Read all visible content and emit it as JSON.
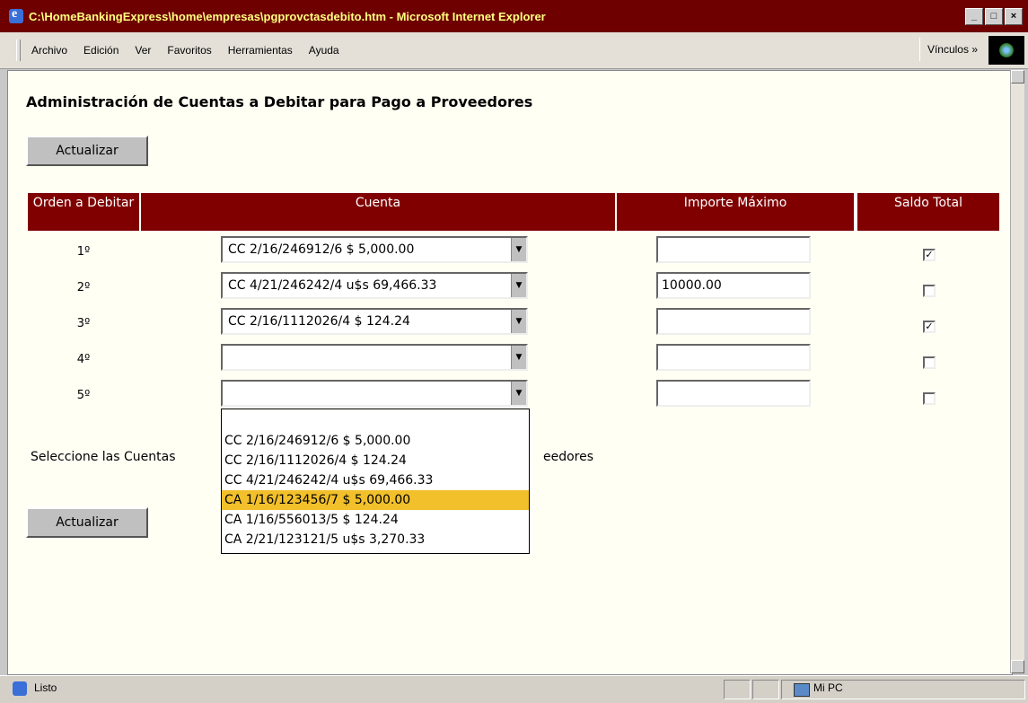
{
  "window": {
    "title": "C:\\HomeBankingExpress\\home\\empresas\\pgprovctasdebito.htm - Microsoft Internet Explorer",
    "min": "_",
    "max": "□",
    "close": "×"
  },
  "menu": {
    "items": [
      "Archivo",
      "Edición",
      "Ver",
      "Favoritos",
      "Herramientas",
      "Ayuda"
    ],
    "links": "Vínculos »"
  },
  "page": {
    "title": "Administración de Cuentas a Debitar para Pago a Proveedores",
    "refresh_top": "Actualizar",
    "refresh_bottom": "Actualizar",
    "note_start": "Seleccione las Cuentas",
    "note_end": "eedores"
  },
  "table": {
    "headers": {
      "order": "Orden a Debitar",
      "account": "Cuenta",
      "max_amount": "Importe Máximo",
      "total_balance": "Saldo Total"
    },
    "rows": [
      {
        "order": "1º",
        "account": "CC 2/16/246912/6 $ 5,000.00",
        "max_amount": "",
        "total_balance": true
      },
      {
        "order": "2º",
        "account": "CC 4/21/246242/4 u$s 69,466.33",
        "max_amount": "10000.00",
        "total_balance": false
      },
      {
        "order": "3º",
        "account": "CC 2/16/1112026/4 $ 124.24",
        "max_amount": "",
        "total_balance": true
      },
      {
        "order": "4º",
        "account": "",
        "max_amount": "",
        "total_balance": false
      },
      {
        "order": "5º",
        "account": "",
        "max_amount": "",
        "total_balance": false
      }
    ]
  },
  "dropdown": {
    "options": [
      "CC 2/16/246912/6 $ 5,000.00",
      "CC 2/16/1112026/4 $ 124.24",
      "CC 4/21/246242/4 u$s 69,466.33",
      "CA 1/16/123456/7 $ 5,000.00",
      "CA 1/16/556013/5 $ 124.24",
      "CA 2/21/123121/5 u$s 3,270.33"
    ],
    "highlighted_index": 3
  },
  "status": {
    "text": "Listo",
    "zone": "Mi PC"
  },
  "colors": {
    "header_bg": "#800000",
    "highlight": "#f2c02a"
  }
}
